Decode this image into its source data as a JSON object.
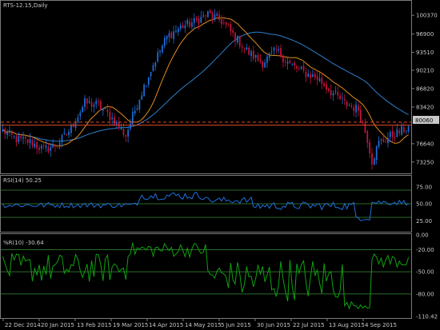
{
  "chart_data": [
    {
      "type": "candlestick",
      "title": "RTS-12.15,Daily",
      "current_price_label": "80060",
      "price_scale_labels": [
        "100370",
        "96900",
        "93510",
        "90210",
        "86820",
        "83420",
        "76640",
        "73250"
      ],
      "ylim": [
        71300,
        102900
      ],
      "x_labels": [
        "22 Dec 2014",
        "20 Jan 2015",
        "13 Feb 2015",
        "19 Mar 2015",
        "14 Apr 2015",
        "14 May 2015",
        "5 Jun 2015",
        "30 Jun 2015",
        "22 Jul 2015",
        "13 Aug 2015",
        "4 Sep 2015"
      ],
      "close_path": [
        [
          0,
          79000
        ],
        [
          6,
          77500
        ],
        [
          12,
          77000
        ],
        [
          18,
          75500
        ],
        [
          24,
          76500
        ],
        [
          30,
          79500
        ],
        [
          36,
          84200
        ],
        [
          42,
          83800
        ],
        [
          48,
          81300
        ],
        [
          54,
          78200
        ],
        [
          60,
          85200
        ],
        [
          66,
          91300
        ],
        [
          72,
          96400
        ],
        [
          78,
          98200
        ],
        [
          84,
          99100
        ],
        [
          90,
          100600
        ],
        [
          96,
          99300
        ],
        [
          102,
          96300
        ],
        [
          108,
          93400
        ],
        [
          114,
          91600
        ],
        [
          120,
          93900
        ],
        [
          126,
          91300
        ],
        [
          132,
          89800
        ],
        [
          138,
          88800
        ],
        [
          144,
          86300
        ],
        [
          150,
          84100
        ],
        [
          156,
          83000
        ],
        [
          160,
          77500
        ],
        [
          162,
          73500
        ],
        [
          165,
          76800
        ],
        [
          170,
          78000
        ],
        [
          178,
          79700
        ]
      ],
      "bar_count": 179,
      "colors": {
        "up": "#1e6fd9",
        "down": "#c8143c",
        "ma_fast": "#e08c1e",
        "ma_slow": "#2f7ec8",
        "level": "#e04a2a"
      },
      "price_levels": [
        {
          "value": 80060,
          "style": "solid"
        },
        {
          "value": 80620,
          "style": "dashed"
        }
      ]
    },
    {
      "type": "line",
      "title": "RSI(14) 50.25",
      "scale_labels": [
        "75.00",
        "50.00",
        "25.00"
      ],
      "ylim": [
        10,
        90
      ],
      "levels": [
        70,
        50,
        30
      ],
      "color": "#1e6fd9"
    },
    {
      "type": "line",
      "title": "%R(10) -30.64",
      "scale_labels": [
        "0.00",
        "-20.00",
        "-50.00",
        "-80.00",
        "-110.42"
      ],
      "ylim": [
        -110.42,
        0
      ],
      "levels": [
        -20,
        -50,
        -80
      ],
      "color": "#10a010"
    }
  ]
}
